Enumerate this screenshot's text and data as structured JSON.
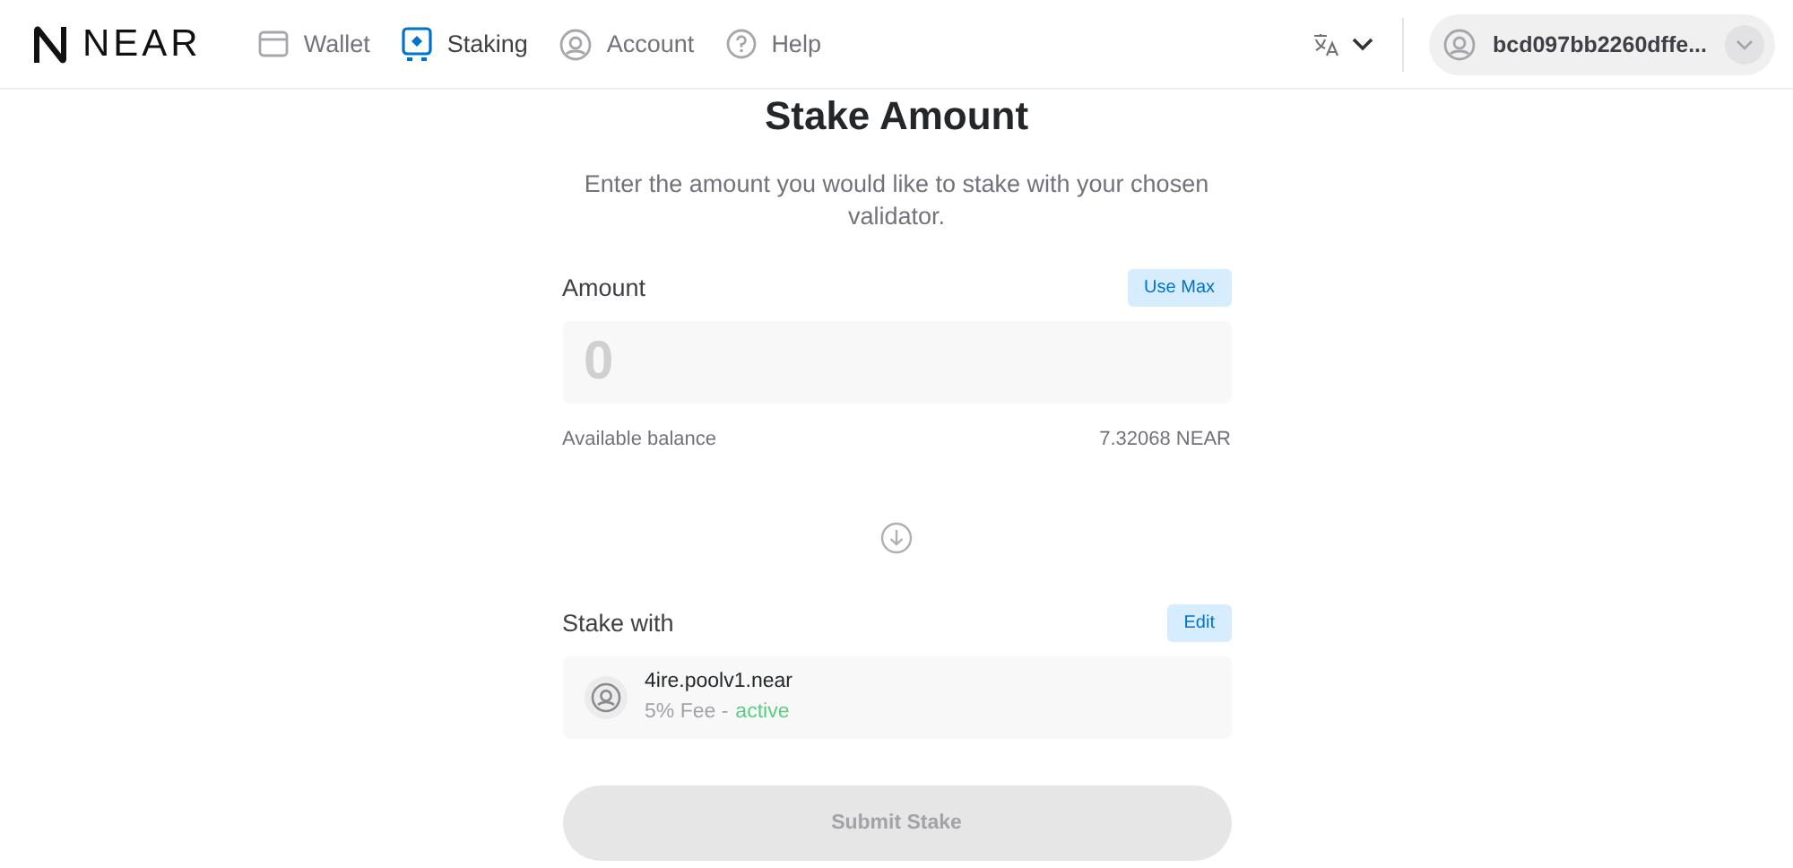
{
  "header": {
    "logo": "NEAR",
    "nav": [
      {
        "label": "Wallet",
        "kind": "wallet",
        "selected": false
      },
      {
        "label": "Staking",
        "kind": "staking",
        "selected": true
      },
      {
        "label": "Account",
        "kind": "account",
        "selected": false
      },
      {
        "label": "Help",
        "kind": "help",
        "selected": false
      }
    ],
    "account": "bcd097bb2260dffe..."
  },
  "title": "Stake Amount",
  "subtitle": "Enter the amount you would like to stake with your chosen validator.",
  "amount": {
    "label": "Amount",
    "use_max": "Use Max",
    "placeholder": "0",
    "balance_label": "Available balance",
    "balance": "7.32068 NEAR"
  },
  "stake_with": {
    "label": "Stake with",
    "edit": "Edit",
    "validator": "4ire.poolv1.near",
    "fee": "5% Fee -",
    "status": "active",
    "active": true
  },
  "submit": {
    "label": "Submit Stake",
    "disabled": true
  }
}
